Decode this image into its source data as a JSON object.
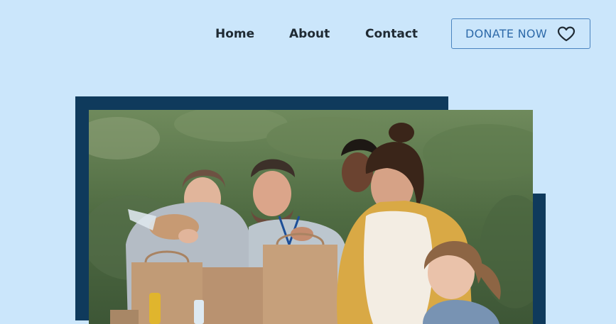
{
  "nav": {
    "items": [
      {
        "label": "Home"
      },
      {
        "label": "About"
      },
      {
        "label": "Contact"
      }
    ]
  },
  "donate": {
    "label": "DONATE NOW",
    "icon": "heart-outline-icon"
  },
  "hero": {
    "photo": "volunteers-food-donation-photo"
  },
  "colors": {
    "background": "#cbe6fb",
    "frame": "#0f3a5c",
    "nav_text": "#1f2a33",
    "donate_accent": "#2e6aa9"
  }
}
